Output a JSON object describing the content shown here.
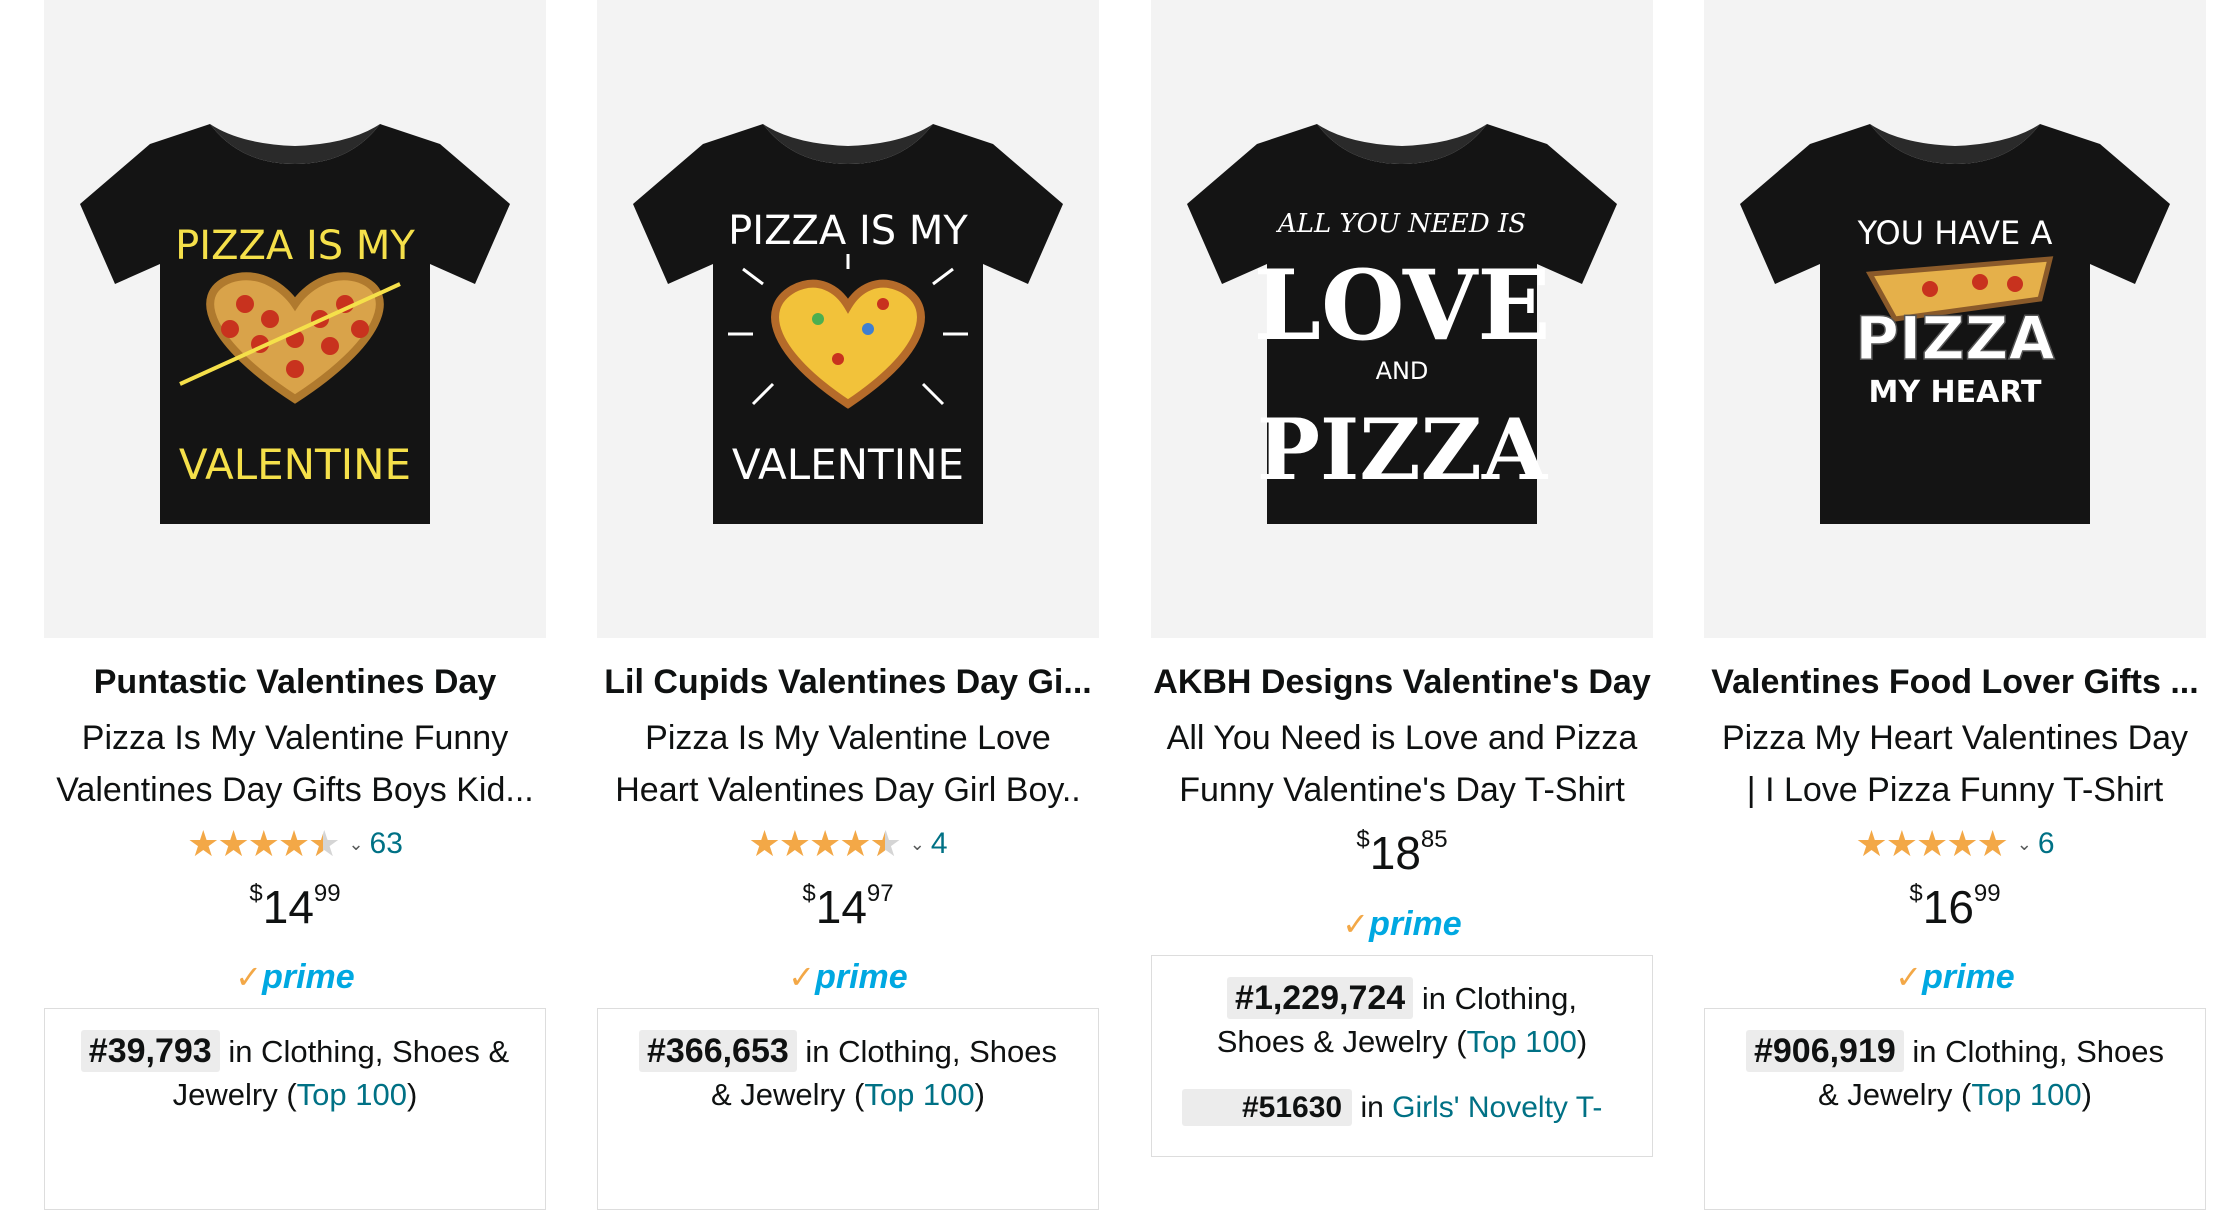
{
  "products": [
    {
      "brand": "Puntastic Valentines Day",
      "title_line1": "Pizza Is My Valentine Funny",
      "title_line2": "Valentines Day Gifts Boys Kid...",
      "rating": 4.5,
      "reviews": "63",
      "price": {
        "symbol": "$",
        "whole": "14",
        "fraction": "99"
      },
      "prime": "prime",
      "rank": "#39,793",
      "rank_text_1": "in Clothing, Shoes &",
      "rank_text_2": "Jewelry (",
      "rank_link": "Top 100",
      "rank_close": ")",
      "shirt_art": {
        "line1": "PIZZA IS MY",
        "line2": "VALENTINE",
        "color": "#f5e04a"
      }
    },
    {
      "brand": "Lil Cupids Valentines Day Gi...",
      "title_line1": "Pizza Is My Valentine Love",
      "title_line2": "Heart Valentines Day Girl Boy..",
      "rating": 4.5,
      "reviews": "4",
      "price": {
        "symbol": "$",
        "whole": "14",
        "fraction": "97"
      },
      "prime": "prime",
      "rank": "#366,653",
      "rank_text_1": "in Clothing, Shoes",
      "rank_text_2": "& Jewelry (",
      "rank_link": "Top 100",
      "rank_close": ")",
      "shirt_art": {
        "line1": "PIZZA IS MY",
        "line2": "VALENTINE",
        "color": "#ffffff"
      }
    },
    {
      "brand": "AKBH Designs Valentine's Day",
      "title_line1": "All You Need is Love and Pizza",
      "title_line2": "Funny Valentine's Day T-Shirt",
      "price": {
        "symbol": "$",
        "whole": "18",
        "fraction": "85"
      },
      "prime": "prime",
      "rank": "#1,229,724",
      "rank_text_1": "in Clothing,",
      "rank_text_2": "Shoes & Jewelry (",
      "rank_link": "Top 100",
      "rank_close": ")",
      "sub_rank": "#51630",
      "sub_rank_text": "in",
      "sub_rank_link": "Girls' Novelty T-",
      "shirt_art": {
        "line1": "ALL YOU NEED IS",
        "line2": "LOVE",
        "line3": "AND",
        "line4": "PIZZA",
        "color": "#ffffff"
      }
    },
    {
      "brand": "Valentines Food Lover Gifts ...",
      "title_line1": "Pizza My Heart Valentines Day",
      "title_line2": "| I Love Pizza Funny T-Shirt",
      "rating": 5,
      "reviews": "6",
      "price": {
        "symbol": "$",
        "whole": "16",
        "fraction": "99"
      },
      "prime": "prime",
      "rank": "#906,919",
      "rank_text_1": "in Clothing, Shoes",
      "rank_text_2": "& Jewelry (",
      "rank_link": "Top 100",
      "rank_close": ")",
      "shirt_art": {
        "line1": "YOU HAVE A",
        "line2": "PIZZA",
        "line3": "MY HEART",
        "color": "#ffffff"
      }
    }
  ],
  "colors": {
    "star": "#f3a847",
    "link": "#007185",
    "prime": "#00a8e1"
  },
  "icons": {
    "rating": "star-icon",
    "chevron": "chevron-down-icon",
    "prime_check": "prime-check-icon"
  }
}
